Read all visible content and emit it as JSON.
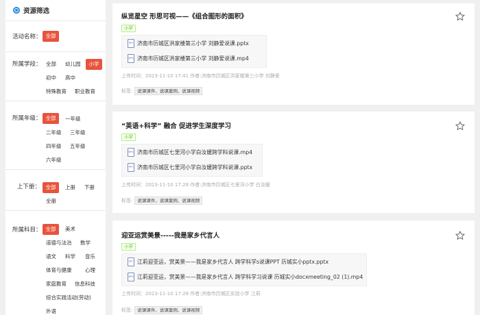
{
  "sidebar": {
    "title": "资源筛选",
    "groups": {
      "activity": {
        "label": "活动名称：",
        "options": [
          "全部"
        ]
      },
      "stage": {
        "label": "所属学段：",
        "options": [
          "全部",
          "幼儿园",
          "小学",
          "初中",
          "高中",
          "特殊教育",
          "职业教育"
        ]
      },
      "grade": {
        "label": "所属年级：",
        "options": [
          "全部",
          "一年级",
          "二年级",
          "三年级",
          "四年级",
          "五年级",
          "六年级"
        ]
      },
      "volume": {
        "label": "上下册：",
        "options": [
          "全部",
          "上册",
          "下册",
          "全册"
        ]
      },
      "subject": {
        "label": "所属科目：",
        "options": [
          "全部",
          "美术",
          "道德与法治",
          "数学",
          "语文",
          "科学",
          "音乐",
          "体育与健康",
          "心理",
          "家庭教育",
          "信息科技",
          "综合实践活动(劳动)",
          "外语"
        ]
      }
    }
  },
  "cards": [
    {
      "title": "纵览星空 形思可视——《组合图形的面积》",
      "level": "小学",
      "files": [
        {
          "type": "PPT",
          "name": "济南市历城区洪家楼第三小学 刘静爱说课.pptx"
        },
        {
          "type": "MP4",
          "name": "济南市历城区洪家楼第三小学 刘静爱说课.mp4"
        }
      ],
      "meta": "上传时间：2023-11-10 17:41  作者:济南市历城区洪家楼第三小学 刘静爱",
      "tags_label": "标签:",
      "tags": "说课课件、说课案例、说课视频"
    },
    {
      "title": "“英语+科学” 融合 促进学生深度学习",
      "level": "小学",
      "files": [
        {
          "type": "MP4",
          "name": "济南市历城区七里河小学白汝媛跨学科说课.mp4"
        },
        {
          "type": "PPT",
          "name": "济南市历城区七里河小学白汝媛跨学科说课.pptx"
        }
      ],
      "meta": "上传时间：2023-11-10 17:28  作者:济南市历城区七里河小学 白汝媛",
      "tags_label": "标签:",
      "tags": "说课课件、说课案例、说课视频"
    },
    {
      "title": "迎亚运赏美景-----我是家乡代言人",
      "level": "小学",
      "files": [
        {
          "type": "PPT",
          "name": "江莉迎亚运，赏美景——我是家乡代言人 跨学科学s说课PPT 历城实小pptx.pptx"
        },
        {
          "type": "MP4",
          "name": "江莉迎亚运，赏美景——我是家乡代言人 跨学科学习说课 历城实小docxmeeting_02 (1).mp4"
        }
      ],
      "meta": "上传时间：2023-11-10 17:28  作者:济南市历城区实验小学 江莉",
      "tags_label": "标签:",
      "tags": "说课课件、说课案例、说课视频"
    }
  ]
}
